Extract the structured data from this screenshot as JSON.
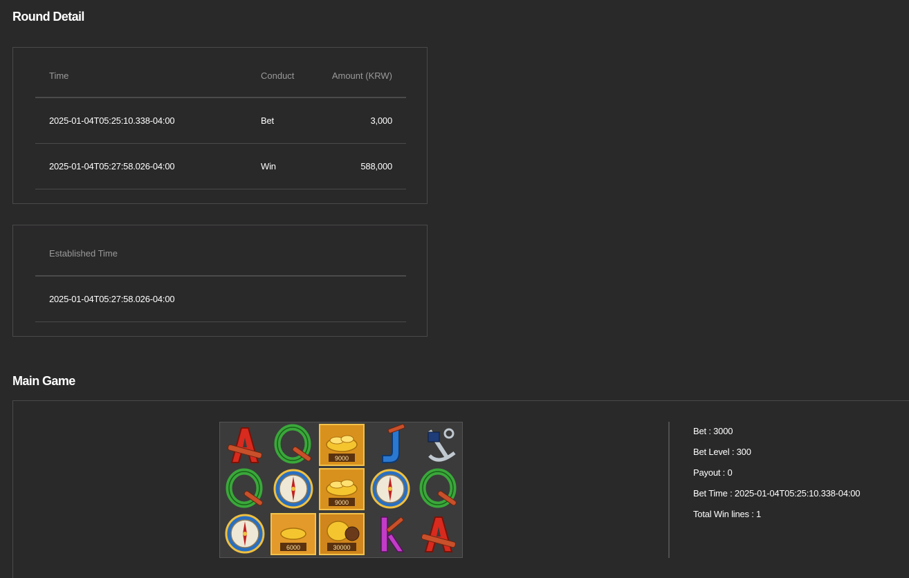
{
  "round_detail": {
    "title": "Round Detail",
    "headers": {
      "time": "Time",
      "conduct": "Conduct",
      "amount": "Amount (KRW)"
    },
    "rows": [
      {
        "time": "2025-01-04T05:25:10.338-04:00",
        "conduct": "Bet",
        "amount": "3,000"
      },
      {
        "time": "2025-01-04T05:27:58.026-04:00",
        "conduct": "Win",
        "amount": "588,000"
      }
    ]
  },
  "established": {
    "header": "Established Time",
    "value": "2025-01-04T05:27:58.026-04:00"
  },
  "main_game": {
    "title": "Main Game",
    "reels": [
      [
        "A",
        "Q",
        "gold:9000",
        "J",
        "anchor"
      ],
      [
        "Q",
        "compass",
        "gold:9000",
        "compass",
        "Q"
      ],
      [
        "compass",
        "gold:6000",
        "chest:30000",
        "K",
        "A"
      ]
    ],
    "cell_values": {
      "r0c2": "9000",
      "r1c2": "9000",
      "r2c1": "6000",
      "r2c2": "30000"
    },
    "info": {
      "bet": "Bet : 3000",
      "bet_level": "Bet Level : 300",
      "payout": "Payout : 0",
      "bet_time": "Bet Time : 2025-01-04T05:25:10.338-04:00",
      "win_lines": "Total Win lines : 1"
    }
  },
  "colors": {
    "background": "#2a292a",
    "border": "#4a4a4a",
    "header_text": "#9a9a9a"
  }
}
